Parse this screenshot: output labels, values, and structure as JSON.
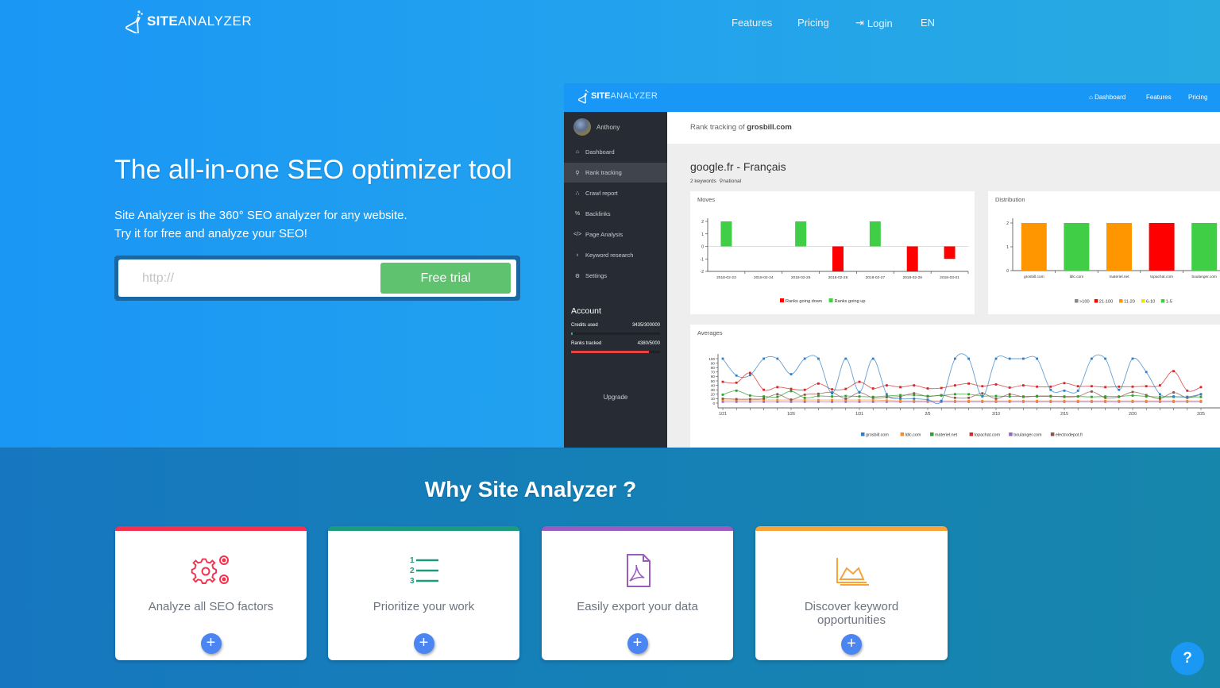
{
  "brand": {
    "site": "SITE",
    "analyzer": "ANALYZER"
  },
  "nav": {
    "features": "Features",
    "pricing": "Pricing",
    "login": "Login",
    "lang": "EN"
  },
  "hero": {
    "title": "The all-in-one SEO optimizer tool",
    "subtitle_line1": "Site Analyzer is the 360° SEO analyzer for any website.",
    "subtitle_line2": "Try it for free and analyze your SEO!",
    "url_placeholder": "http://",
    "cta": "Free trial"
  },
  "app": {
    "nav": {
      "dashboard": "Dashboard",
      "features": "Features",
      "pricing": "Pricing"
    },
    "user": "Anthony",
    "sidebar": [
      {
        "icon": "home-icon",
        "glyph": "⌂",
        "label": "Dashboard",
        "active": false
      },
      {
        "icon": "search-icon",
        "glyph": "⚲",
        "label": "Rank tracking",
        "active": true
      },
      {
        "icon": "sitemap-icon",
        "glyph": "⛬",
        "label": "Crawl report",
        "active": false
      },
      {
        "icon": "link-icon",
        "glyph": "%",
        "label": "Backlinks",
        "active": false
      },
      {
        "icon": "code-icon",
        "glyph": "</>",
        "label": "Page Analysis",
        "active": false
      },
      {
        "icon": "lightbulb-icon",
        "glyph": "♁",
        "label": "Keyword research",
        "active": false
      },
      {
        "icon": "cogs-icon",
        "glyph": "⚙",
        "label": "Settings",
        "active": false
      }
    ],
    "account": {
      "title": "Account",
      "credits_label": "Credits used",
      "credits_value": "3435/300000",
      "credits_fraction": 0.0115,
      "ranks_label": "Ranks tracked",
      "ranks_value": "4380/5000",
      "ranks_fraction": 0.876,
      "upgrade": "Upgrade"
    },
    "rank_tracking_prefix": "Rank tracking of ",
    "rank_tracking_domain": "grosbill.com",
    "engine": "google.fr - Français",
    "keywords": "2 keywords",
    "scope": "national",
    "colors": {
      "green": "#3fce46",
      "red": "#ff0000",
      "orange": "#ff9600",
      "yellow": "#e8e800",
      "gray": "#888888"
    }
  },
  "chart_data": [
    {
      "title": "Moves",
      "type": "bar",
      "categories": [
        "2018-02-23",
        "2018-02-24",
        "2018-02-25",
        "2018-02-26",
        "2018-02-27",
        "2018-02-28",
        "2018-03-01"
      ],
      "series": [
        {
          "name": "Ranks going down",
          "color": "#ff0000",
          "values": [
            0,
            0,
            0,
            -2,
            0,
            -2,
            -1
          ]
        },
        {
          "name": "Ranks going up",
          "color": "#3fce46",
          "values": [
            2,
            0,
            2,
            0,
            2,
            0,
            0
          ]
        }
      ],
      "ylim": [
        -2,
        2
      ],
      "yticks": [
        "2",
        "1",
        "0",
        "-1",
        "-2"
      ],
      "legend": "bottom"
    },
    {
      "title": "Distribution",
      "type": "bar",
      "categories": [
        "grosbill.com",
        "ldlc.com",
        "materiel.net",
        "topachat.com",
        "boulanger.com"
      ],
      "values": [
        2,
        2,
        2,
        2,
        2
      ],
      "bar_buckets": [
        "11-20",
        "1-5",
        "11-20",
        "21-100",
        "1-5"
      ],
      "legend_entries": [
        {
          "name": ">100",
          "color": "#888888"
        },
        {
          "name": "21-100",
          "color": "#ff0000"
        },
        {
          "name": "11-20",
          "color": "#ff9600"
        },
        {
          "name": "6-10",
          "color": "#e8e800"
        },
        {
          "name": "1-5",
          "color": "#3fce46"
        }
      ],
      "ylim": [
        0,
        2
      ],
      "yticks": [
        "2",
        "1",
        "0"
      ],
      "legend": "bottom"
    },
    {
      "title": "Averages",
      "type": "line",
      "x_tick_labels": [
        "1/21",
        "1/26",
        "1/31",
        "2/5",
        "2/10",
        "2/15",
        "2/20",
        "2/25"
      ],
      "ylim": [
        0,
        100
      ],
      "yticks": [
        "100",
        "90",
        "80",
        "70",
        "60",
        "50",
        "40",
        "30",
        "20",
        "10",
        "0"
      ],
      "legend": "bottom",
      "series": [
        {
          "name": "grosbill.com",
          "color": "#2f7fc6",
          "values": [
            100,
            62,
            63,
            100,
            100,
            65,
            100,
            100,
            22,
            100,
            25,
            100,
            20,
            10,
            10,
            8,
            5,
            100,
            100,
            15,
            100,
            100,
            100,
            100,
            30,
            28,
            28,
            100,
            100,
            30,
            100,
            70,
            20,
            15,
            14,
            20
          ]
        },
        {
          "name": "ldlc.com",
          "color": "#ff8c1a",
          "values": [
            7,
            7,
            7,
            7,
            7,
            7,
            7,
            7,
            7,
            7,
            7,
            7,
            6,
            5,
            5,
            5,
            5,
            5,
            5,
            5,
            5,
            5,
            5,
            5,
            5,
            5,
            5,
            5,
            5,
            5,
            5,
            5,
            5,
            5,
            5,
            5
          ]
        },
        {
          "name": "materiel.net",
          "color": "#2ca02c",
          "values": [
            19,
            28,
            17,
            15,
            14,
            27,
            12,
            16,
            15,
            16,
            15,
            14,
            16,
            18,
            18,
            16,
            17,
            20,
            20,
            16,
            16,
            15,
            15,
            15,
            15,
            15,
            15,
            14,
            15,
            15,
            17,
            15,
            14,
            14,
            14,
            14
          ]
        },
        {
          "name": "topachat.com",
          "color": "#d62728",
          "values": [
            48,
            46,
            68,
            30,
            36,
            32,
            30,
            44,
            31,
            32,
            48,
            33,
            40,
            36,
            40,
            33,
            34,
            40,
            44,
            38,
            42,
            35,
            40,
            37,
            37,
            45,
            38,
            38,
            36,
            37,
            37,
            38,
            40,
            72,
            28,
            36
          ]
        },
        {
          "name": "boulanger.com",
          "color": "#9467bd",
          "values": [
            3,
            3,
            3,
            3,
            3,
            3,
            3,
            3,
            3,
            3,
            3,
            3,
            3,
            3,
            3,
            3,
            3,
            3,
            3,
            3,
            3,
            3,
            3,
            3,
            3,
            3,
            3,
            3,
            3,
            3,
            3,
            3,
            3,
            3,
            3,
            3
          ]
        },
        {
          "name": "electrodepot.fr",
          "color": "#8c564b",
          "values": [
            10,
            9,
            9,
            10,
            20,
            8,
            19,
            21,
            24,
            10,
            24,
            12,
            13,
            15,
            22,
            15,
            18,
            12,
            12,
            22,
            10,
            20,
            14,
            16,
            16,
            14,
            15,
            26,
            12,
            14,
            25,
            18,
            10,
            24,
            12,
            20
          ]
        }
      ]
    }
  ],
  "why": {
    "title": "Why Site Analyzer ?",
    "cards": [
      {
        "label": "Analyze all SEO factors",
        "icon": "gears-icon",
        "color": "#f4304d"
      },
      {
        "label": "Prioritize your work",
        "icon": "numbered-list-icon",
        "color": "#1b9b7d"
      },
      {
        "label": "Easily export your data",
        "icon": "pdf-file-icon",
        "color": "#9b5cbf"
      },
      {
        "label": "Discover keyword opportunities",
        "icon": "area-chart-icon",
        "color": "#f8a23a"
      }
    ],
    "plus": "+"
  },
  "help": "?"
}
